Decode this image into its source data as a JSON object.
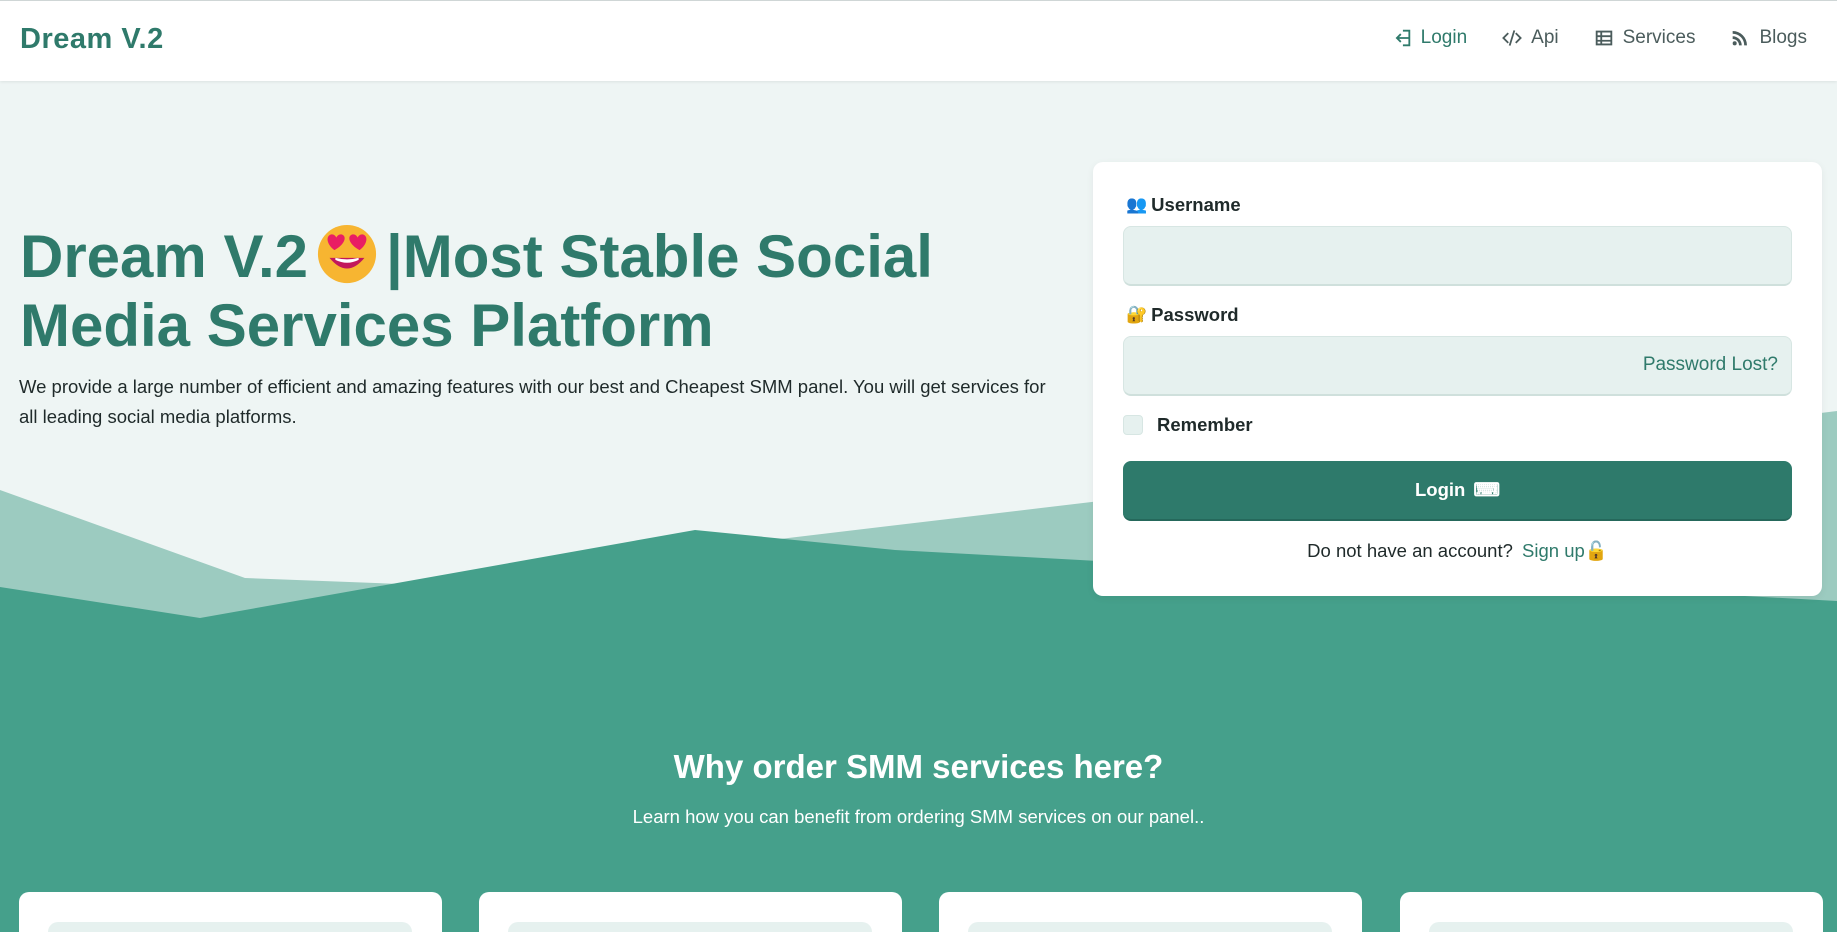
{
  "header": {
    "brand": "Dream V.2",
    "nav": [
      {
        "label": "Login",
        "icon": "sign-in-icon"
      },
      {
        "label": "Api",
        "icon": "code-icon"
      },
      {
        "label": "Services",
        "icon": "list-icon"
      },
      {
        "label": "Blogs",
        "icon": "rss-icon"
      }
    ]
  },
  "hero": {
    "title_part1": "Dream V.2",
    "title_emoji": "star-struck-emoji",
    "title_part2": "|Most Stable Social Media Services Platform",
    "description": "We provide a large number of efficient and amazing features with our best and Cheapest SMM panel. You will get services for all leading social media platforms."
  },
  "login": {
    "username_icon": "👥",
    "username_label": "Username",
    "username_value": "",
    "password_icon": "🔐",
    "password_label": "Password",
    "password_value": "",
    "password_lost": "Password Lost?",
    "remember_label": "Remember",
    "remember_checked": false,
    "button_label": "Login",
    "button_icon": "⌨",
    "no_account_text": "Do not have an account?",
    "signup_link": "Sign up",
    "signup_icon": "🔓"
  },
  "why": {
    "title": "Why order SMM services here?",
    "subtitle": "Learn how you can benefit from ordering SMM services on our panel.."
  },
  "colors": {
    "brand": "#2f7a6b",
    "hero_bg": "#eef5f4",
    "wave_light": "#9ccbc0",
    "wave_dark": "#45a08b",
    "input_bg": "#e6f1ef"
  }
}
